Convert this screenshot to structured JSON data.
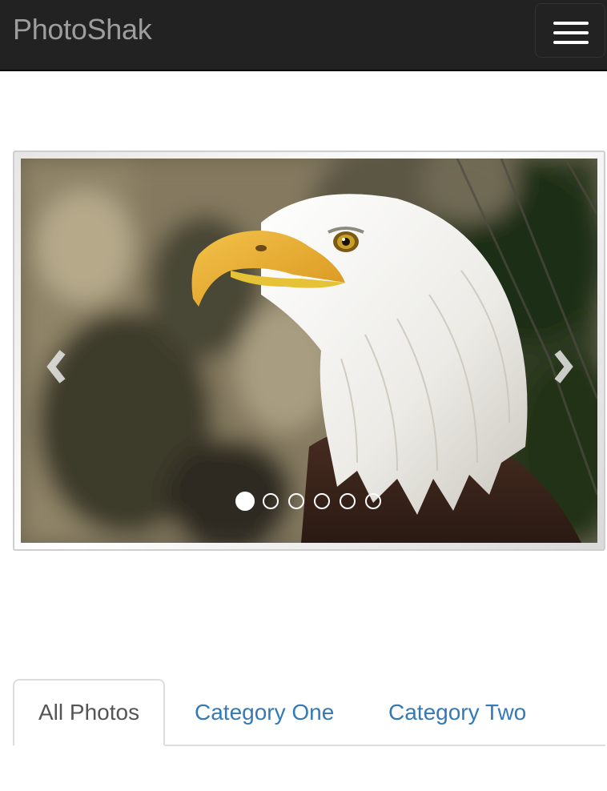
{
  "navbar": {
    "brand": "PhotoShak",
    "colors": {
      "background": "#222222",
      "brand_text": "#9d9d9d",
      "toggle_bar": "#ffffff"
    }
  },
  "carousel": {
    "image_subject": "bald eagle",
    "prev_icon": "chevron-left-icon",
    "next_icon": "chevron-right-icon",
    "slide_count": 6,
    "active_slide": 1
  },
  "tabs": [
    {
      "label": "All Photos",
      "active": true
    },
    {
      "label": "Category One",
      "active": false
    },
    {
      "label": "Category Two",
      "active": false
    }
  ],
  "colors": {
    "link": "#337ab7",
    "active_tab_text": "#555555",
    "tab_border": "#dddddd"
  }
}
